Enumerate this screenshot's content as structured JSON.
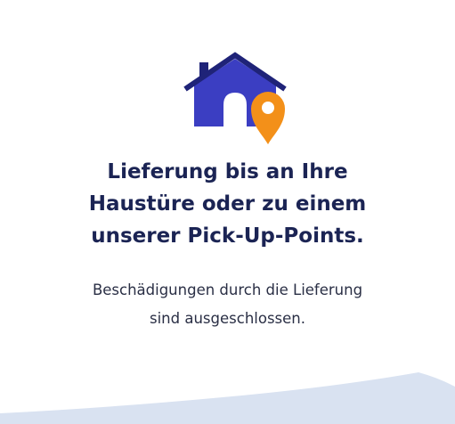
{
  "hero": {
    "icon": "house-with-location-pin-icon",
    "colors": {
      "house": "#3b3ec2",
      "roof": "#1f2378",
      "pin": "#f39019"
    }
  },
  "headline": {
    "lines": [
      "Lieferung bis an Ihre",
      "Haustüre oder zu einem",
      "unserer Pick-Up-Points."
    ]
  },
  "subtext": {
    "lines": [
      "Beschädigungen durch die Lieferung",
      "sind ausgeschlossen."
    ]
  },
  "decoration": {
    "wave_color": "#d9e2f1"
  }
}
